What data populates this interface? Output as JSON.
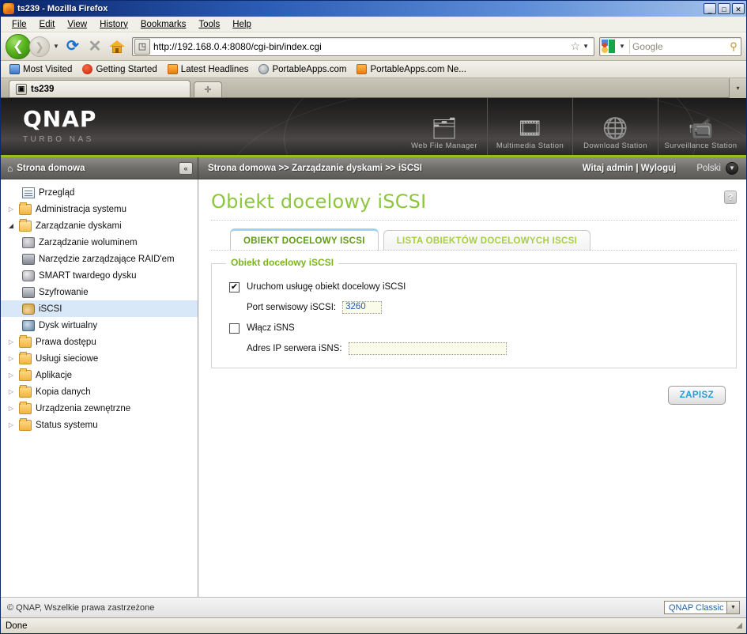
{
  "window": {
    "title": "ts239 - Mozilla Firefox",
    "favicon_name": "firefox-icon",
    "minimize": "_",
    "maximize": "□",
    "close": "✕"
  },
  "menubar": [
    {
      "label": "File"
    },
    {
      "label": "Edit"
    },
    {
      "label": "View"
    },
    {
      "label": "History"
    },
    {
      "label": "Bookmarks"
    },
    {
      "label": "Tools"
    },
    {
      "label": "Help"
    }
  ],
  "toolbar": {
    "back_icon": "❮",
    "forward_icon": "❯",
    "history_caret": "▼",
    "reload_icon": "⟳",
    "stop_icon": "✕",
    "home_icon": "home-icon",
    "identity_icon": "◳",
    "url": "http://192.168.0.4:8080/cgi-bin/index.cgi",
    "bookmark_star": "☆",
    "url_caret": "▼",
    "search_engine": "google-icon",
    "search_caret": "▼",
    "search_placeholder": "Google",
    "search_value": "",
    "magnifier_icon": "🔍"
  },
  "bookmarks": [
    {
      "label": "Most Visited",
      "icon": "star-page-icon"
    },
    {
      "label": "Getting Started",
      "icon": "firefox-icon"
    },
    {
      "label": "Latest Headlines",
      "icon": "rss-icon"
    },
    {
      "label": "PortableApps.com",
      "icon": "portableapps-icon"
    },
    {
      "label": "PortableApps.com Ne...",
      "icon": "rss-icon"
    }
  ],
  "browser_tabs": {
    "tabs": [
      {
        "label": "ts239",
        "favicon": "qnap-icon"
      }
    ],
    "new_tab_icon": "✛",
    "tab_list_caret": "▾"
  },
  "qnap_header": {
    "brand": "QNAP",
    "tagline": "TURBO NAS",
    "apps": [
      {
        "label": "Web File Manager",
        "icon": "folder-search-icon",
        "glyph": "🗂"
      },
      {
        "label": "Multimedia Station",
        "icon": "multimedia-icon",
        "glyph": "🎞"
      },
      {
        "label": "Download Station",
        "icon": "download-icon",
        "glyph": "🌐"
      },
      {
        "label": "Surveillance Station",
        "icon": "camera-icon",
        "glyph": "📹"
      }
    ]
  },
  "navbar": {
    "home_icon": "⌂",
    "home_label": "Strona domowa",
    "collapse_icon": "«",
    "breadcrumb": "Strona domowa >> Zarządzanie dyskami >> iSCSI",
    "welcome": "Witaj admin | Wyloguj",
    "language": "Polski",
    "language_caret": "▼"
  },
  "sidebar": {
    "items": [
      {
        "label": "Przegląd",
        "icon": "overview-icon",
        "level": 0,
        "twisty": "",
        "selected": false
      },
      {
        "label": "Administracja systemu",
        "icon": "folder-icon",
        "level": 0,
        "twisty": "▷",
        "selected": false
      },
      {
        "label": "Zarządzanie dyskami",
        "icon": "folder-open-icon",
        "level": 0,
        "twisty": "◢",
        "selected": false
      },
      {
        "label": "Zarządzanie woluminem",
        "icon": "volume-icon",
        "level": 1,
        "twisty": "",
        "selected": false
      },
      {
        "label": "Narzędzie zarządzające RAID'em",
        "icon": "raid-icon",
        "level": 1,
        "twisty": "",
        "selected": false
      },
      {
        "label": "SMART twardego dysku",
        "icon": "smart-icon",
        "level": 1,
        "twisty": "",
        "selected": false
      },
      {
        "label": "Szyfrowanie",
        "icon": "lock-icon",
        "level": 1,
        "twisty": "",
        "selected": false
      },
      {
        "label": "iSCSI",
        "icon": "iscsi-icon",
        "level": 1,
        "twisty": "",
        "selected": true
      },
      {
        "label": "Dysk wirtualny",
        "icon": "virtual-disk-icon",
        "level": 1,
        "twisty": "",
        "selected": false
      },
      {
        "label": "Prawa dostępu",
        "icon": "folder-icon",
        "level": 0,
        "twisty": "▷",
        "selected": false
      },
      {
        "label": "Usługi sieciowe",
        "icon": "folder-icon",
        "level": 0,
        "twisty": "▷",
        "selected": false
      },
      {
        "label": "Aplikacje",
        "icon": "folder-icon",
        "level": 0,
        "twisty": "▷",
        "selected": false
      },
      {
        "label": "Kopia danych",
        "icon": "folder-icon",
        "level": 0,
        "twisty": "▷",
        "selected": false
      },
      {
        "label": "Urządzenia zewnętrzne",
        "icon": "folder-icon",
        "level": 0,
        "twisty": "▷",
        "selected": false
      },
      {
        "label": "Status systemu",
        "icon": "folder-icon",
        "level": 0,
        "twisty": "▷",
        "selected": false
      }
    ]
  },
  "main": {
    "page_title": "Obiekt docelowy iSCSI",
    "help_icon": "?",
    "tabs": [
      {
        "label": "OBIEKT DOCELOWY ISCSI",
        "active": true
      },
      {
        "label": "LISTA OBIEKTÓW DOCELOWYCH ISCSI",
        "active": false
      }
    ],
    "panel": {
      "legend": "Obiekt docelowy iSCSI",
      "enable_service": {
        "label": "Uruchom usługę obiekt docelowy iSCSI",
        "checked": true,
        "check_glyph": "✔"
      },
      "port": {
        "label": "Port serwisowy iSCSI:",
        "value": "3260"
      },
      "enable_isns": {
        "label": "Włącz iSNS",
        "checked": false,
        "check_glyph": ""
      },
      "isns_ip": {
        "label": "Adres IP serwera iSNS:",
        "value": "",
        "placeholder": ""
      }
    },
    "save_label": "ZAPISZ"
  },
  "footer": {
    "copyright": "© QNAP, Wszelkie prawa zastrzeżone",
    "theme": "QNAP Classic",
    "theme_caret": "▼"
  },
  "statusbar": {
    "text": "Done",
    "grip": "◢"
  },
  "colors": {
    "accent_green": "#8cc63e",
    "header_green_rule": "#93c01f",
    "tab_active_text": "#5e9c16",
    "tab_inactive_text": "#a8cf3f",
    "save_text": "#1f9ed6",
    "selected_row": "#d9e8f8",
    "input_value": "#1f5fa8"
  }
}
